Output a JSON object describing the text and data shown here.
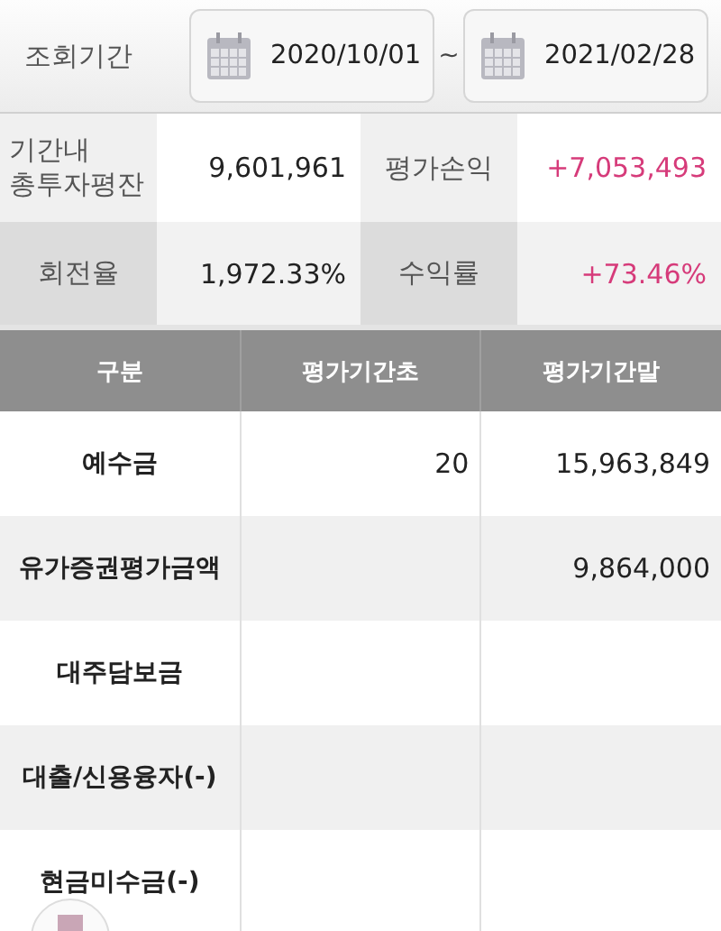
{
  "period": {
    "label": "조회기간",
    "start": "2020/10/01",
    "separator": "~",
    "end": "2021/02/28"
  },
  "summary": [
    {
      "label": "기간내\n총투자평잔",
      "value": "9,601,961",
      "label2": "평가손익",
      "value2": "+7,053,493"
    },
    {
      "label": "회전율",
      "value": "1,972.33%",
      "label2": "수익률",
      "value2": "+73.46%"
    }
  ],
  "table": {
    "columns": [
      "구분",
      "평가기간초",
      "평가기간말"
    ],
    "rows": [
      [
        "예수금",
        "20",
        "15,963,849"
      ],
      [
        "유가증권평가금액",
        "",
        "9,864,000"
      ],
      [
        "대주담보금",
        "",
        ""
      ],
      [
        "대출/신용융자(-)",
        "",
        ""
      ],
      [
        "현금미수금(-)",
        "",
        ""
      ]
    ]
  }
}
